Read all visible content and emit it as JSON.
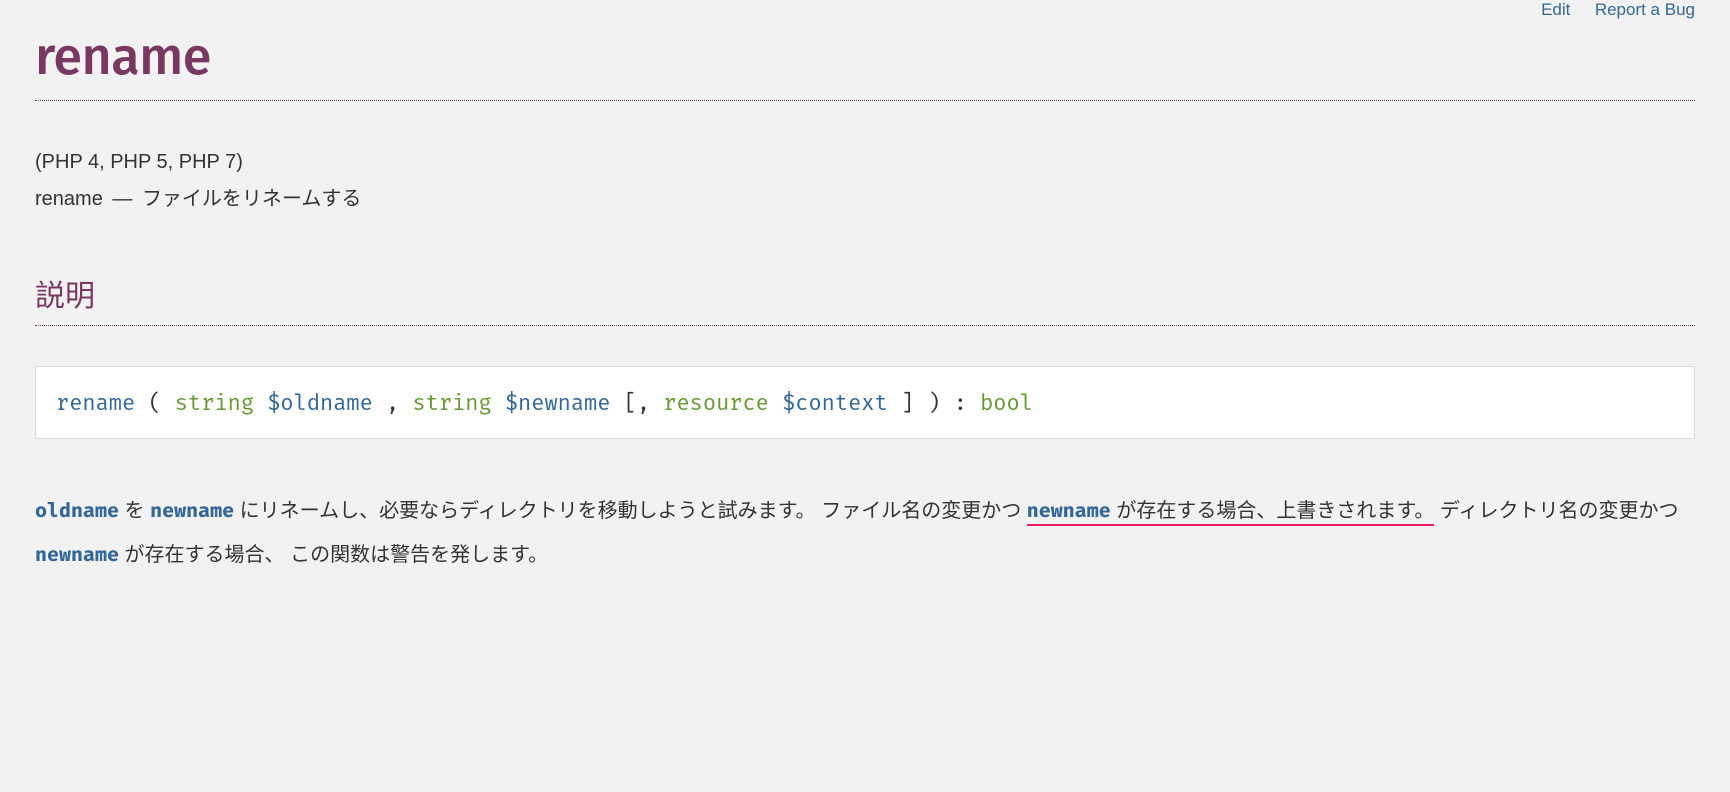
{
  "topLinks": {
    "edit": "Edit",
    "reportBug": "Report a Bug"
  },
  "title": "rename",
  "versionInfo": "(PHP 4, PHP 5, PHP 7)",
  "refpurpose": {
    "name": "rename",
    "dash": "—",
    "desc": "ファイルをリネームする"
  },
  "sectionTitle": "説明",
  "synopsis": {
    "funcName": "rename",
    "open": " ( ",
    "type1": "string",
    "param1": "$oldname",
    "comma1": " , ",
    "type2": "string",
    "param2": "$newname",
    "optOpen": " [, ",
    "type3": "resource",
    "param3": "$context",
    "optClose": " ] ) : ",
    "returnType": "bool"
  },
  "description": {
    "p1": "oldname",
    "t1": " を ",
    "p2": "newname",
    "t2": " にリネームし、必要ならディレクトリを移動しようと試みます。 ファイル名の変更かつ ",
    "p3": "newname",
    "t3": " が存在する場合、上書きされます。",
    "t4": " ディレクトリ名の変更かつ ",
    "p4": "newname",
    "t5": " が存在する場合、 この関数は警告を発します。"
  }
}
